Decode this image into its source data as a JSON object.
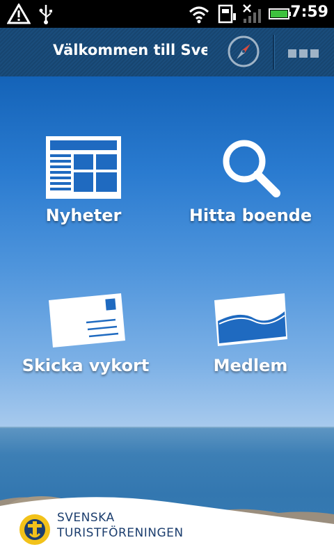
{
  "statusbar": {
    "time": "7:59",
    "icons": [
      "warning-icon",
      "usb-icon",
      "wifi-icon",
      "sim-icon",
      "signal-icon",
      "battery-icon"
    ]
  },
  "header": {
    "title": "Välkommen till Sve",
    "compass_icon": "compass-icon",
    "menu_icon": "menu-dots-icon"
  },
  "tiles": [
    {
      "label": "Nyheter",
      "icon": "newspaper-icon"
    },
    {
      "label": "Hitta boende",
      "icon": "search-icon"
    },
    {
      "label": "Skicka vykort",
      "icon": "postcard-icon"
    },
    {
      "label": "Medlem",
      "icon": "member-card-icon"
    }
  ],
  "footer": {
    "brand_line1": "SVENSKA",
    "brand_line2": "TURISTFÖRENINGEN",
    "logo_icon": "stf-logo-icon"
  },
  "colors": {
    "statusbar": "#000000",
    "titlebar": "#1a4d7c",
    "sky_top": "#1463b8",
    "sky_bottom": "#d9e8f6",
    "brand_text": "#1c3e6e"
  }
}
